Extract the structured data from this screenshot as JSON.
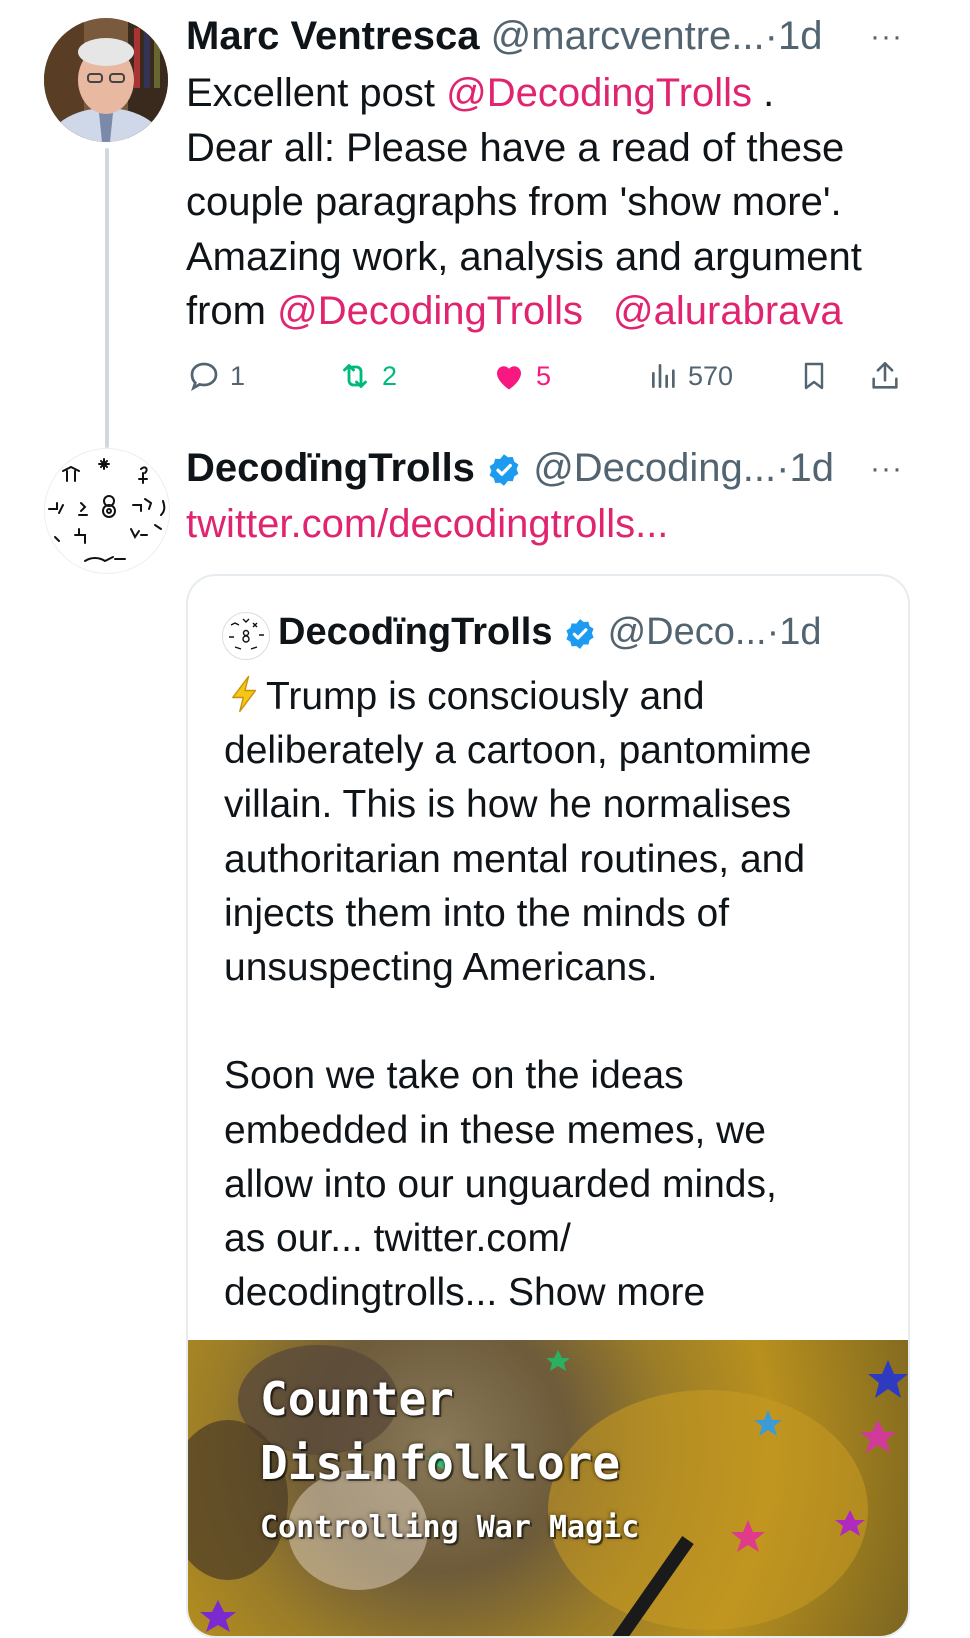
{
  "tweet1": {
    "author_name": "Marc Ventresca",
    "handle": "@marcventre...",
    "time": "1d",
    "text_prefix": "Excellent post ",
    "mention1": "@DecodingTrolls",
    "line1_end": " .",
    "line2": "Dear all:  Please have a read of these",
    "line3": "couple paragraphs  from 'show more'.",
    "line4": "Amazing work, analysis and argument",
    "line5_prefix": "from ",
    "mention2": "@DecodingTrolls",
    "mention3": "@alurabrava",
    "stats": {
      "replies": "1",
      "retweets": "2",
      "likes": "5",
      "views": "570"
    }
  },
  "tweet2": {
    "author_name": "DecodïngTrolls",
    "handle": "@Decoding...",
    "time": "1d",
    "link": "twitter.com/decodingtrolls..."
  },
  "quote": {
    "author_name": "DecodïngTrolls",
    "handle": "@Deco...",
    "time": "1d",
    "lines": [
      "Trump is consciously and",
      "deliberately a cartoon, pantomime",
      "villain. This is how he normalises",
      "authoritarian mental routines, and",
      "injects them into the minds of",
      "unsuspecting Americans.",
      "",
      "Soon we take on the ideas",
      "embedded in these memes, we",
      "allow into our unguarded minds,",
      "as our... twitter.com/",
      "decodingtrolls... Show more"
    ],
    "media": {
      "title1": "Counter",
      "title2": "Disinfolklore",
      "subtitle": "Controlling War Magic"
    }
  },
  "colors": {
    "accent": "#e0246f",
    "verified": "#1d9bf0",
    "retweet": "#00ba7c",
    "like": "#f91880",
    "muted": "#536471"
  }
}
